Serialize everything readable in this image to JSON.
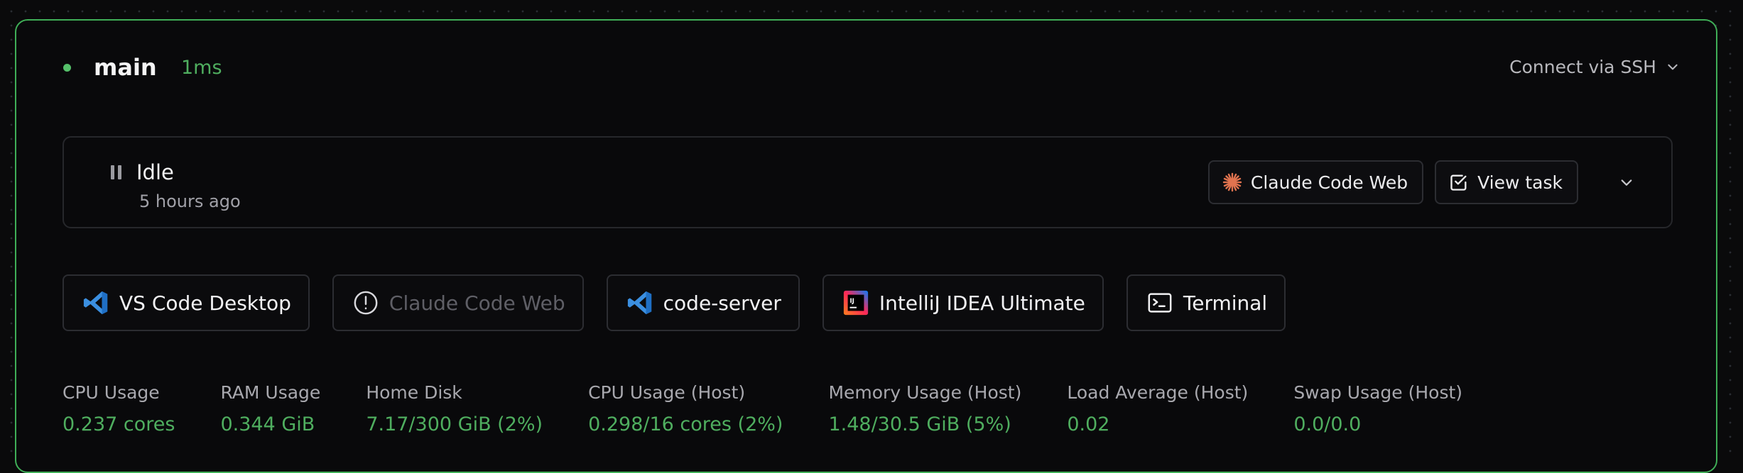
{
  "agent": {
    "name": "main",
    "latency": "1ms",
    "ssh_label": "Connect via SSH"
  },
  "status": {
    "state": "Idle",
    "time": "5 hours ago",
    "claude_label": "Claude Code Web",
    "view_task_label": "View task"
  },
  "apps": [
    {
      "label": "VS Code Desktop",
      "icon": "vscode-icon",
      "disabled": false
    },
    {
      "label": "Claude Code Web",
      "icon": "alert-circle-icon",
      "disabled": true
    },
    {
      "label": "code-server",
      "icon": "vscode-icon",
      "disabled": false
    },
    {
      "label": "IntelliJ IDEA Ultimate",
      "icon": "intellij-icon",
      "disabled": false
    },
    {
      "label": "Terminal",
      "icon": "terminal-icon",
      "disabled": false
    }
  ],
  "metrics": [
    {
      "label": "CPU Usage",
      "value": "0.237 cores"
    },
    {
      "label": "RAM Usage",
      "value": "0.344 GiB"
    },
    {
      "label": "Home Disk",
      "value": "7.17/300 GiB (2%)"
    },
    {
      "label": "CPU Usage (Host)",
      "value": "0.298/16 cores (2%)"
    },
    {
      "label": "Memory Usage (Host)",
      "value": "1.48/30.5 GiB (5%)"
    },
    {
      "label": "Load Average (Host)",
      "value": "0.02"
    },
    {
      "label": "Swap Usage (Host)",
      "value": "0.0/0.0"
    }
  ],
  "colors": {
    "accent_green": "#4fae5f",
    "border_green": "#3fae57",
    "claude_orange": "#e0734f",
    "vscode_blue": "#3b8fe0"
  }
}
